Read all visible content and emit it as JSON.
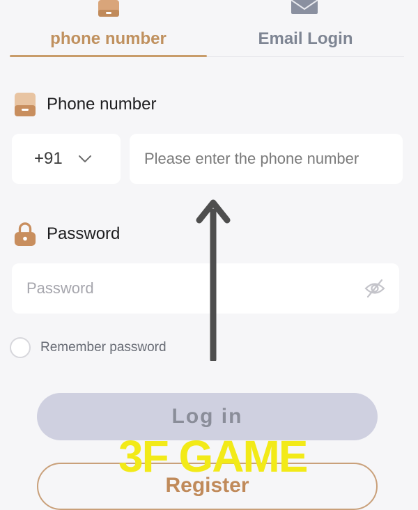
{
  "tabs": [
    {
      "label": "phone number",
      "icon": "phone-icon",
      "active": true,
      "color": "#c0915f"
    },
    {
      "label": "Email Login",
      "icon": "mail-icon",
      "active": false,
      "color": "#7e8593"
    }
  ],
  "phone_section": {
    "label": "Phone number",
    "icon": "phone-icon",
    "country_code": "+91",
    "placeholder": "Please enter the phone number",
    "value": ""
  },
  "password_section": {
    "label": "Password",
    "icon": "lock-icon",
    "placeholder": "Password",
    "value": "",
    "visibility_icon": "eye-off-icon"
  },
  "remember": {
    "label": "Remember password",
    "checked": false
  },
  "buttons": {
    "login": "Log in",
    "register": "Register"
  },
  "overlay": {
    "watermark": "3F GAME",
    "arrow": "arrow-up"
  },
  "colors": {
    "accent": "#c89c6a",
    "background": "#f6f6f8",
    "login_bg": "#cfd0e0",
    "watermark": "#f2ea18"
  }
}
